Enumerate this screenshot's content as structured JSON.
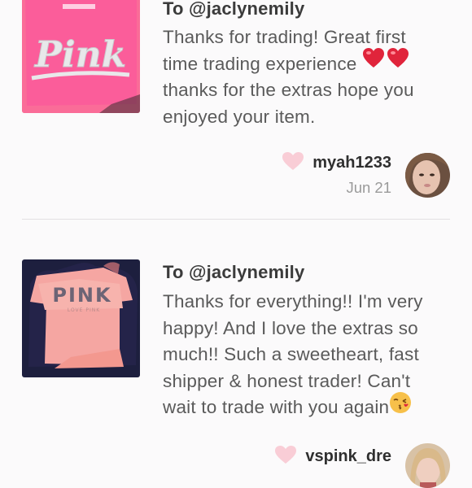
{
  "reviews": [
    {
      "recipient": "To @jaclynemily",
      "message_lines": [
        "Thanks for trading! Great first",
        "time trading experience",
        "thanks for the extras hope you",
        "enjoyed your item."
      ],
      "author": "myah1233",
      "date": "Jun 21",
      "thumbnail": {
        "shirt_text": "Pink",
        "color": "#f96fa3"
      }
    },
    {
      "recipient": "To @jaclynemily",
      "message_lines": [
        "Thanks for everything!! I'm very",
        "happy! And I love the extras so",
        "much!! Such a sweetheart, fast",
        "shipper & honest trader! Can't",
        "wait to trade with you again"
      ],
      "author": "vspink_dre",
      "thumbnail": {
        "shirt_text": "PINK",
        "sub_text": "LOVE PINK",
        "color": "#f48a8c"
      }
    }
  ],
  "icons": {
    "heart_emoji": "heart-icon",
    "kiss_emoji": "kiss-face-icon",
    "like": "heart-like-icon"
  },
  "colors": {
    "like_heart": "#f9cdd6",
    "emoji_heart": "#e0243b",
    "divider": "#e2e0e2"
  }
}
